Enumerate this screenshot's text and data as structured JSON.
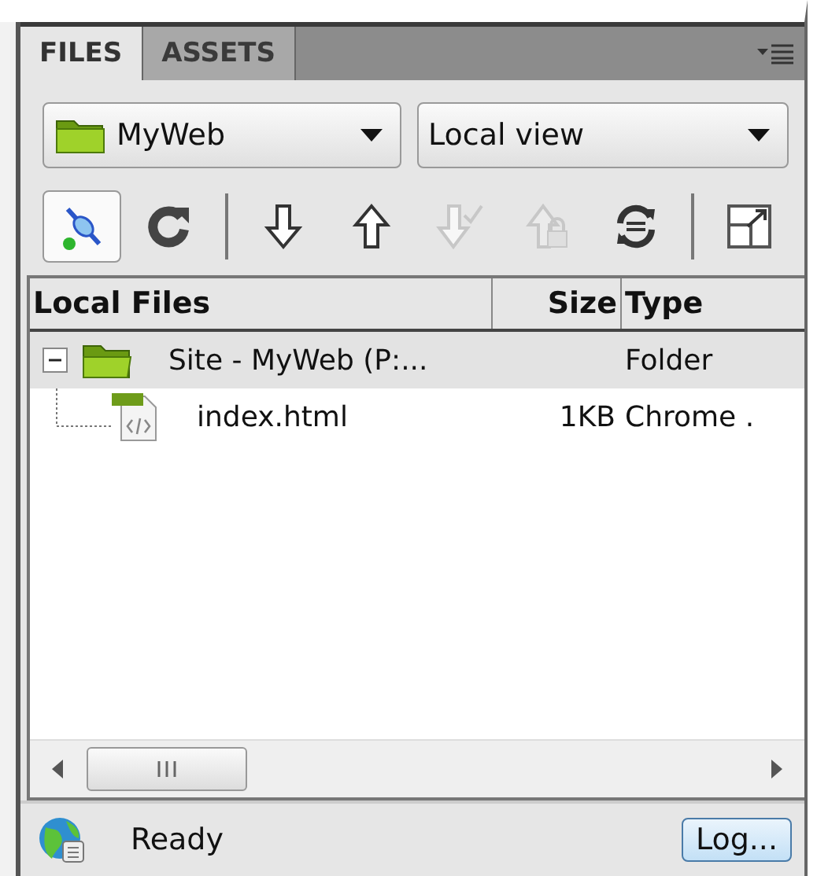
{
  "tabs": [
    {
      "label": "FILES",
      "selected": true
    },
    {
      "label": "ASSETS",
      "selected": false
    }
  ],
  "site_select": {
    "value": "MyWeb"
  },
  "view_select": {
    "value": "Local view"
  },
  "toolbar": [
    {
      "kind": "connect",
      "pressed": true,
      "disabled": false
    },
    {
      "kind": "refresh",
      "pressed": false,
      "disabled": false
    },
    {
      "kind": "separator"
    },
    {
      "kind": "get",
      "pressed": false,
      "disabled": false
    },
    {
      "kind": "put",
      "pressed": false,
      "disabled": false
    },
    {
      "kind": "checkout",
      "pressed": false,
      "disabled": true
    },
    {
      "kind": "checkin",
      "pressed": false,
      "disabled": true
    },
    {
      "kind": "sync",
      "pressed": false,
      "disabled": false
    },
    {
      "kind": "separator"
    },
    {
      "kind": "expand",
      "pressed": false,
      "disabled": false
    }
  ],
  "table": {
    "columns": [
      "Local Files",
      "Size",
      "Type"
    ],
    "rows": [
      {
        "kind": "folder",
        "name": "Site - MyWeb (P:...",
        "size": "",
        "type": "Folder",
        "expanded": true,
        "selected": true,
        "children": [
          {
            "kind": "file",
            "name": "index.html",
            "size": "1KB",
            "type": "Chrome .",
            "selected": false
          }
        ]
      }
    ]
  },
  "status_bar": {
    "text": "Ready",
    "button": "Log..."
  }
}
